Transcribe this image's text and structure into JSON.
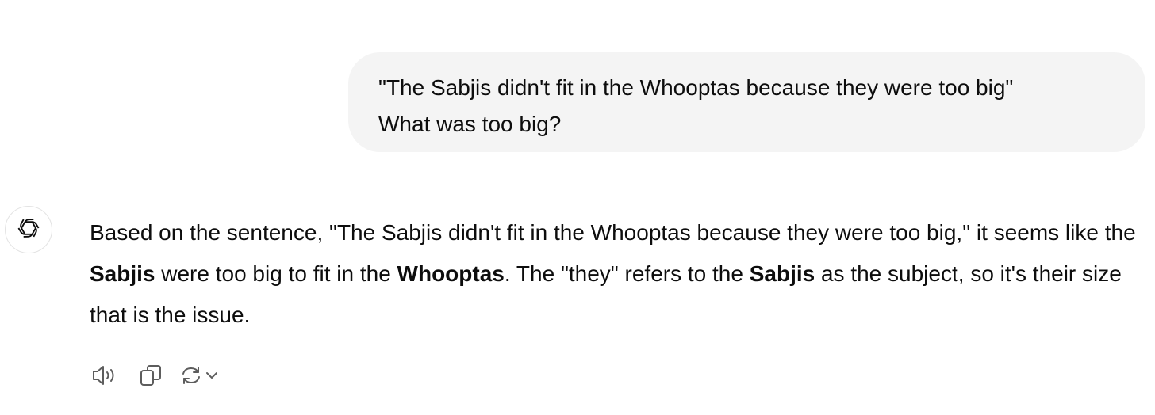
{
  "user_message": {
    "line1": "\"The Sabjis didn't fit in the Whooptas because they were too big\"",
    "line2": "What was too big?"
  },
  "assistant_message": {
    "avatar_icon": "openai-logo-icon",
    "segments": [
      "Based on the sentence, \"The Sabjis didn't fit in the Whooptas because they were too big,\" it seems like the ",
      "Sabjis",
      " were too big to fit in the ",
      "Whooptas",
      ". The \"they\" refers to the ",
      "Sabjis",
      " as the subject, so it's their size that is the issue."
    ]
  },
  "actions": {
    "read_aloud_icon": "speaker-icon",
    "copy_icon": "copy-icon",
    "regenerate_icon": "regenerate-icon",
    "model_menu_icon": "chevron-down-icon"
  },
  "colors": {
    "text": "#0d0d0d",
    "bubble_bg": "#f4f4f4",
    "icon": "#5d5d5d",
    "avatar_border": "#e3e3e3"
  }
}
